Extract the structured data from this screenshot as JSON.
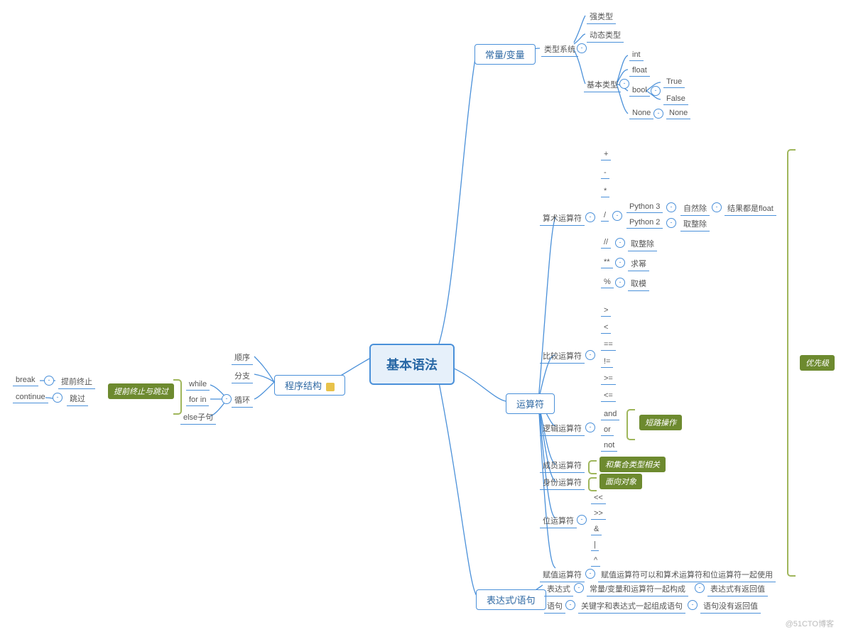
{
  "root": "基本语法",
  "watermark": "@51CTO博客",
  "const_var": {
    "title": "常量/变量",
    "type_sys": "类型系统",
    "strong": "强类型",
    "dynamic": "动态类型",
    "basic_type": "基本类型",
    "int": "int",
    "float": "float",
    "bool": "bool",
    "true": "True",
    "false": "False",
    "none": "None",
    "none2": "None"
  },
  "struct": {
    "title": "程序结构",
    "seq": "顺序",
    "branch": "分支",
    "loop": "循环",
    "while": "while",
    "forin": "for in",
    "elsec": "else子句",
    "earlyexit": "提前终止与跳过",
    "break": "break",
    "continue": "continue",
    "break_note": "提前终止",
    "continue_note": "跳过"
  },
  "op": {
    "title": "运算符",
    "priority": "优先级",
    "arith": "算术运算符",
    "arith_ops": {
      "plus": "+",
      "minus": "-",
      "mul": "*",
      "div": "/",
      "floordiv": "//",
      "pow": "**",
      "mod": "%"
    },
    "div_py3": "Python 3",
    "div_py3_r": "自然除",
    "div_py3_r2": "结果都是float",
    "div_py2": "Python 2",
    "div_py2_r": "取整除",
    "floordiv_r": "取整除",
    "pow_r": "求幂",
    "mod_r": "取模",
    "cmp": "比较运算符",
    "cmp_ops": {
      "gt": ">",
      "lt": "<",
      "eq": "==",
      "ne": "!=",
      "ge": ">=",
      "le": "<="
    },
    "logic": "逻辑运算符",
    "logic_and": "and",
    "logic_or": "or",
    "logic_not": "not",
    "logic_short": "短路操作",
    "member": "成员运算符",
    "member_note": "和集合类型相关",
    "ident": "身份运算符",
    "ident_note": "面向对象",
    "bit": "位运算符",
    "bit_ops": {
      "shl": "<<",
      "shr": ">>",
      "and": "&",
      "or": "|",
      "xor": "^"
    },
    "assign": "赋值运算符",
    "assign_note": "赋值运算符可以和算术运算符和位运算符一起使用"
  },
  "expr": {
    "title": "表达式/语句",
    "expr": "表达式",
    "expr_make": "常量/变量和运算符一起构成",
    "expr_ret": "表达式有返回值",
    "stmt": "语句",
    "stmt_make": "关键字和表达式一起组成语句",
    "stmt_ret": "语句没有返回值"
  }
}
